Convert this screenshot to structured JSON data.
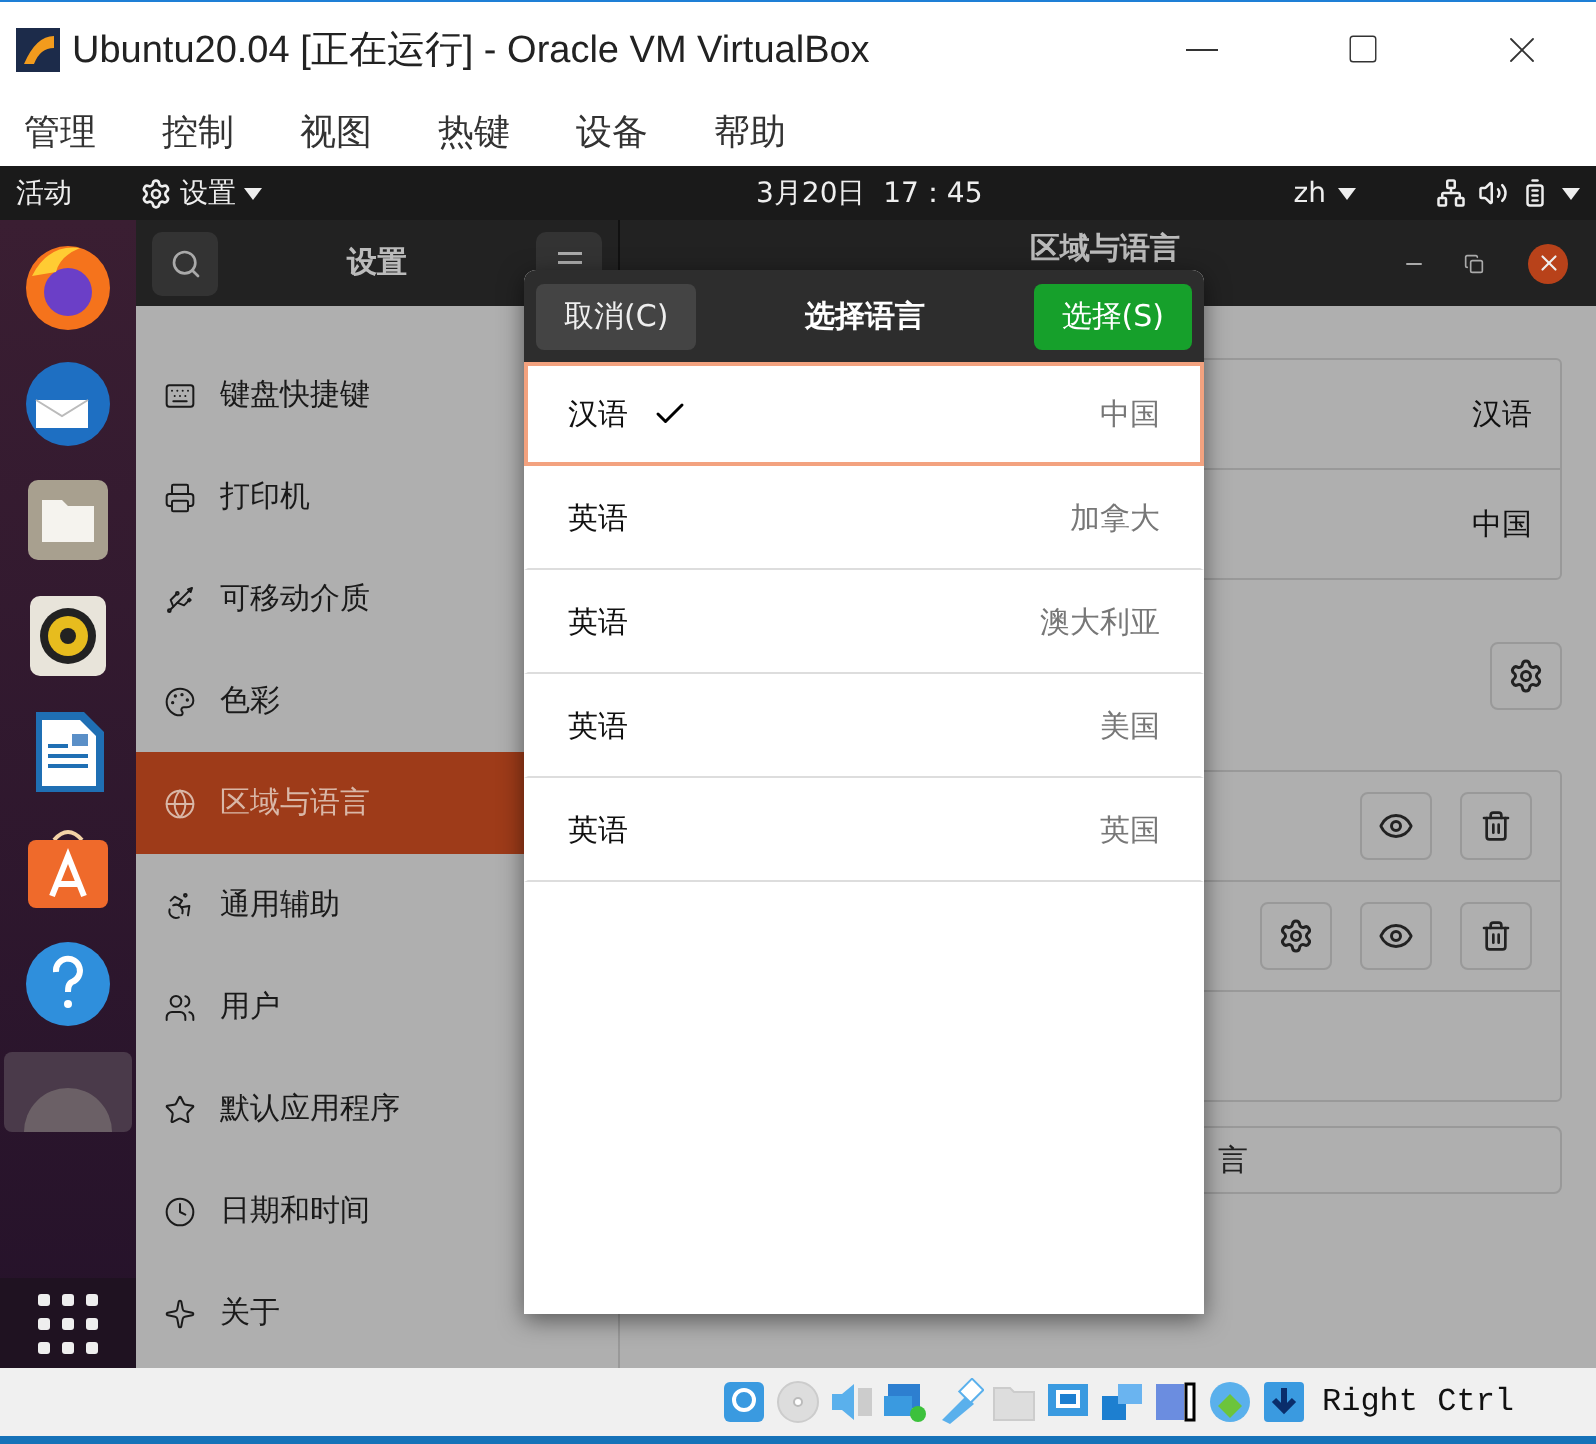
{
  "window": {
    "title": "Ubuntu20.04 [正在运行] - Oracle VM VirtualBox"
  },
  "menu": [
    "管理",
    "控制",
    "视图",
    "热键",
    "设备",
    "帮助"
  ],
  "top_bar": {
    "activities": "活动",
    "app_menu": "设置",
    "clock": "3月20日  17：45",
    "input_method": "zh"
  },
  "settings": {
    "title": "设置",
    "page_title": "区域与语言",
    "sidebar": [
      {
        "label": "键盘快捷键",
        "selected": false
      },
      {
        "label": "打印机",
        "selected": false
      },
      {
        "label": "可移动介质",
        "selected": false
      },
      {
        "label": "色彩",
        "selected": false
      },
      {
        "label": "区域与语言",
        "selected": true
      },
      {
        "label": "通用辅助",
        "selected": false
      },
      {
        "label": "用户",
        "selected": false
      },
      {
        "label": "默认应用程序",
        "selected": false
      },
      {
        "label": "日期和时间",
        "selected": false
      },
      {
        "label": "关于",
        "selected": false
      }
    ],
    "region_values": [
      "汉语",
      "中国"
    ],
    "manage_button": "言"
  },
  "dialog": {
    "cancel": "取消(C)",
    "title": "选择语言",
    "select": "选择(S)",
    "languages": [
      {
        "language": "汉语",
        "country": "中国",
        "selected": true
      },
      {
        "language": "英语",
        "country": "加拿大",
        "selected": false
      },
      {
        "language": "英语",
        "country": "澳大利亚",
        "selected": false
      },
      {
        "language": "英语",
        "country": "美国",
        "selected": false
      },
      {
        "language": "英语",
        "country": "英国",
        "selected": false
      }
    ]
  },
  "status_bar": {
    "host_key": "Right Ctrl"
  }
}
